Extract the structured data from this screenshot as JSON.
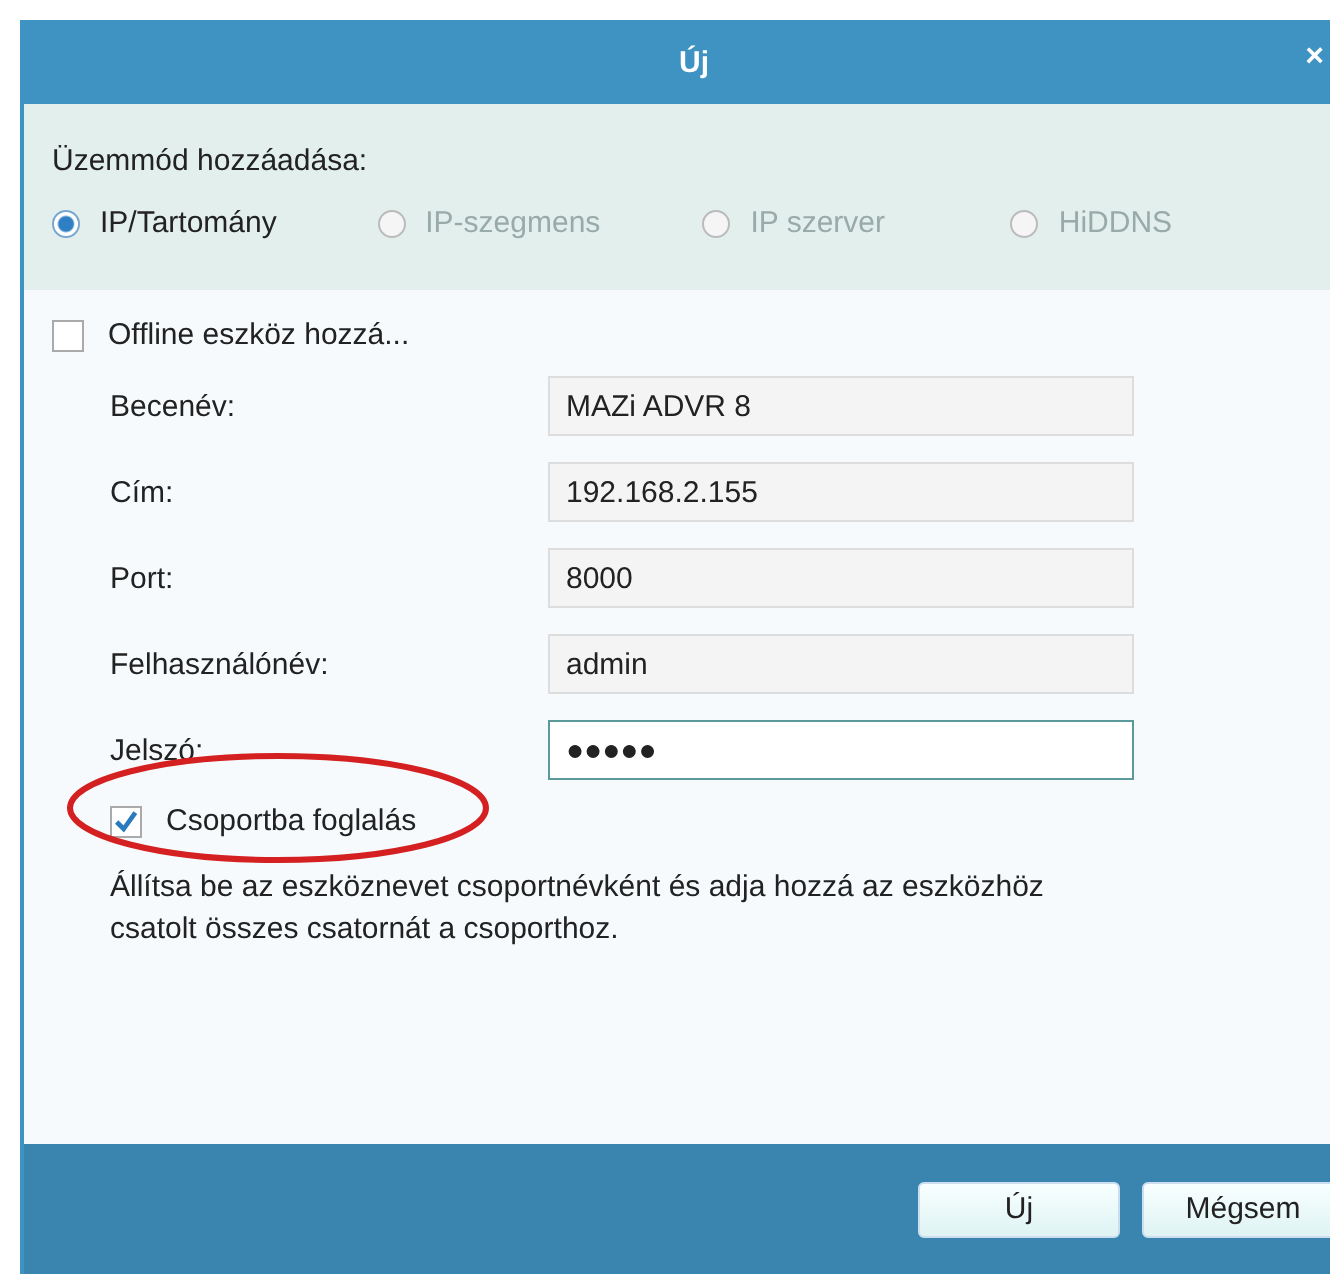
{
  "window": {
    "title": "Új",
    "close": "×"
  },
  "mode": {
    "label": "Üzemmód hozzáadása:",
    "options": [
      {
        "label": "IP/Tartomány",
        "selected": true
      },
      {
        "label": "IP-szegmens",
        "selected": false
      },
      {
        "label": "IP szerver",
        "selected": false
      },
      {
        "label": "HiDDNS",
        "selected": false
      }
    ]
  },
  "offline": {
    "label": "Offline eszköz hozzá...",
    "checked": false
  },
  "fields": [
    {
      "label": "Becenév:",
      "value": "MAZi ADVR 8",
      "focused": false
    },
    {
      "label": "Cím:",
      "value": "192.168.2.155",
      "focused": false
    },
    {
      "label": "Port:",
      "value": "8000",
      "focused": false
    },
    {
      "label": "Felhasználónév:",
      "value": "admin",
      "focused": false
    },
    {
      "label": "Jelszó:",
      "value": "●●●●●",
      "focused": true
    }
  ],
  "group": {
    "label": "Csoportba foglalás",
    "checked": true
  },
  "hint": "Állítsa be az eszköznevet csoportnévként és adja hozzá az eszközhöz csatolt összes csatornát a csoporthoz.",
  "annotation": {
    "kind": "ellipse"
  },
  "buttons": [
    "Új",
    "Mégsem"
  ]
}
